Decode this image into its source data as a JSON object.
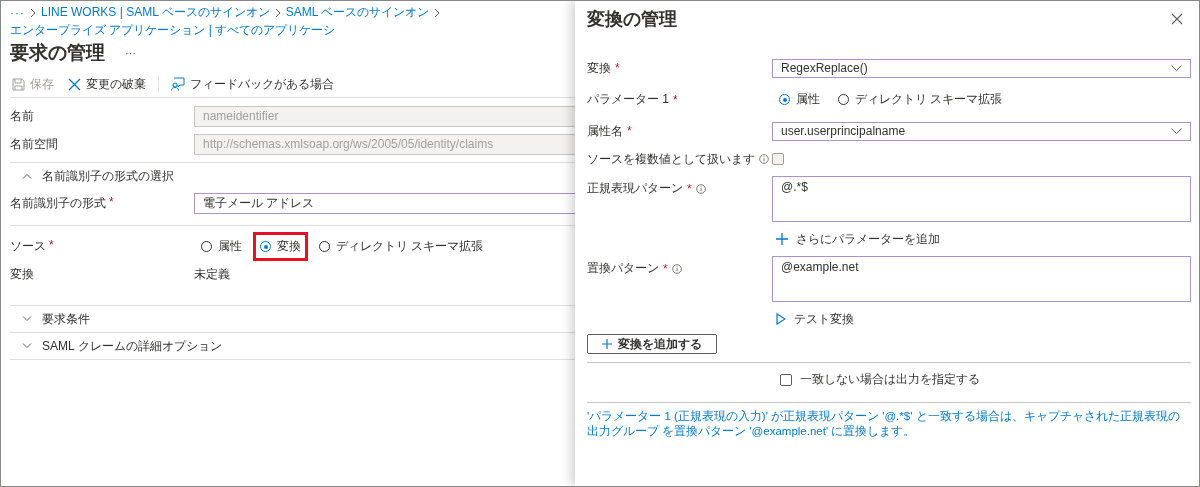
{
  "breadcrumb": {
    "more": "···",
    "items": [
      "LINE WORKS | SAML ベースのサインオン",
      "SAML ベースのサインオン",
      "エンタープライズ アプリケーション | すべてのアプリケーシ"
    ]
  },
  "page": {
    "title": "要求の管理",
    "more": "···"
  },
  "toolbar": [
    {
      "kind": "save",
      "label": "保存",
      "disabled": true
    },
    {
      "kind": "discard",
      "label": "変更の破棄",
      "disabled": false
    },
    {
      "kind": "feedback",
      "label": "フィードバックがある場合",
      "disabled": false
    }
  ],
  "form": [
    {
      "kind": "input",
      "label": "名前",
      "value": "nameidentifier",
      "disabled": true
    },
    {
      "kind": "input",
      "label": "名前空間",
      "value": "http://schemas.xmlsoap.org/ws/2005/05/identity/claims",
      "disabled": true
    },
    {
      "kind": "section",
      "label": "名前識別子の形式の選択",
      "expanded": true
    },
    {
      "kind": "input",
      "label": "名前識別子の形式",
      "required_mark": "*",
      "value": "電子メール アドレス",
      "disabled": false
    },
    {
      "kind": "radio",
      "label": "ソース",
      "required_mark": "*",
      "options": [
        {
          "label": "属性",
          "selected": false,
          "highlighted": false
        },
        {
          "label": "変換",
          "selected": true,
          "highlighted": true
        },
        {
          "label": "ディレクトリ スキーマ拡張",
          "selected": false,
          "highlighted": false
        }
      ]
    },
    {
      "kind": "text",
      "label": "変換",
      "value": "未定義"
    },
    {
      "kind": "section",
      "label": "要求条件",
      "expanded": false
    },
    {
      "kind": "section",
      "label": "SAML クレームの詳細オプション",
      "expanded": false
    }
  ],
  "panel": {
    "title": "変換の管理",
    "rows": [
      {
        "kind": "select",
        "label": "変換",
        "required_mark": "*",
        "info": false,
        "value": "RegexReplace()"
      },
      {
        "kind": "radio",
        "label": "パラメーター 1",
        "required_mark": "*",
        "info": false,
        "options": [
          {
            "label": "属性",
            "selected": true
          },
          {
            "label": "ディレクトリ スキーマ拡張",
            "selected": false
          }
        ]
      },
      {
        "kind": "select",
        "label": "属性名",
        "required_mark": "*",
        "info": false,
        "value": "user.userprincipalname"
      },
      {
        "kind": "checkbox",
        "label": "ソースを複数値として扱います",
        "info": true,
        "checked": false
      },
      {
        "kind": "textarea",
        "label": "正規表現パターン",
        "required_mark": "*",
        "info": true,
        "value": "@.*$"
      },
      {
        "kind": "add_link",
        "label": "さらにパラメーターを追加"
      },
      {
        "kind": "textarea",
        "label": "置換パターン",
        "required_mark": "*",
        "info": true,
        "value": "@example.net"
      },
      {
        "kind": "test_link",
        "label": "テスト変換"
      }
    ],
    "add_button": "変換を追加する",
    "output_option": {
      "label": "一致しない場合は出力を指定する",
      "checked": false
    },
    "footnote": "'パラメーター 1 (正規表現の入力)' が正規表現パターン '@.*$' と一致する場合は、キャプチャされた正規表現の出力グループ を置換パターン '@example.net' に置換します。"
  }
}
